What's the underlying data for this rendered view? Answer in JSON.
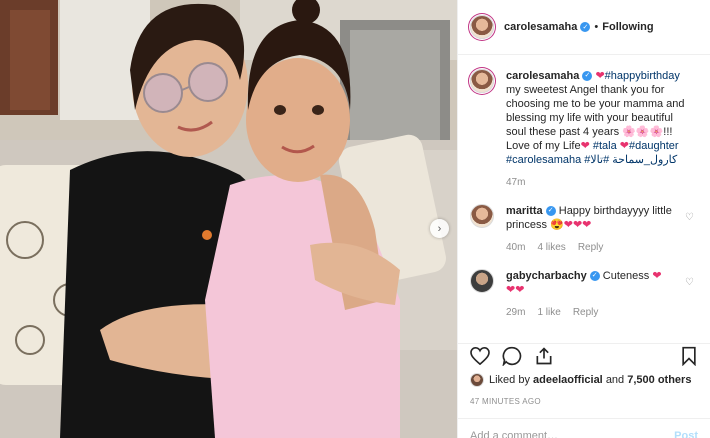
{
  "post": {
    "author": "carolesamaha",
    "follow_status": "Following",
    "separator": "•",
    "next_arrow": "›",
    "caption": {
      "user": "carolesamaha",
      "heart": "❤",
      "tag_birthday": "#happybirthday",
      "text1": "my sweetest Angel thank you for choosing me to be your mamma and blessing my life with your beautiful soul these past 4 years",
      "flowers": "🌸🌸🌸",
      "text2": "!!!",
      "text3": "Love of my Life",
      "heart2": "❤",
      "tag_tala": "#tala",
      "heart3": "❤",
      "tag_daughter": "#daughter",
      "tag_carole": "#carolesamaha",
      "tag_arabic1": "#كارول_سماحة",
      "tag_arabic2": "#تالا",
      "time": "47m"
    },
    "comments": [
      {
        "user": "maritta",
        "verified": true,
        "text": "Happy birthdayyyy little princess",
        "emoji": "😍❤❤❤",
        "time": "40m",
        "likes": "4 likes",
        "reply": "Reply"
      },
      {
        "user": "gabycharbachy",
        "verified": true,
        "text": "Cuteness",
        "emoji": "❤",
        "emoji2": "❤❤",
        "time": "29m",
        "likes": "1 like",
        "reply": "Reply"
      }
    ],
    "likes": {
      "prefix": "Liked by ",
      "user": "adeelaofficial",
      "suffix": " and ",
      "others": "7,500 others"
    },
    "posted_ago": "47 MINUTES AGO",
    "add_comment_placeholder": "Add a comment…",
    "post_label": "Post"
  },
  "icons": {
    "verified": "verified-badge-icon",
    "like": "heart-icon",
    "comment": "comment-bubble-icon",
    "share": "share-icon",
    "save": "bookmark-icon",
    "comment_like": "small-heart-icon"
  },
  "colors": {
    "accent_blue": "#3897f0",
    "heart_red": "#e8336f",
    "hashtag": "#003569",
    "muted": "#8e8e8e"
  }
}
